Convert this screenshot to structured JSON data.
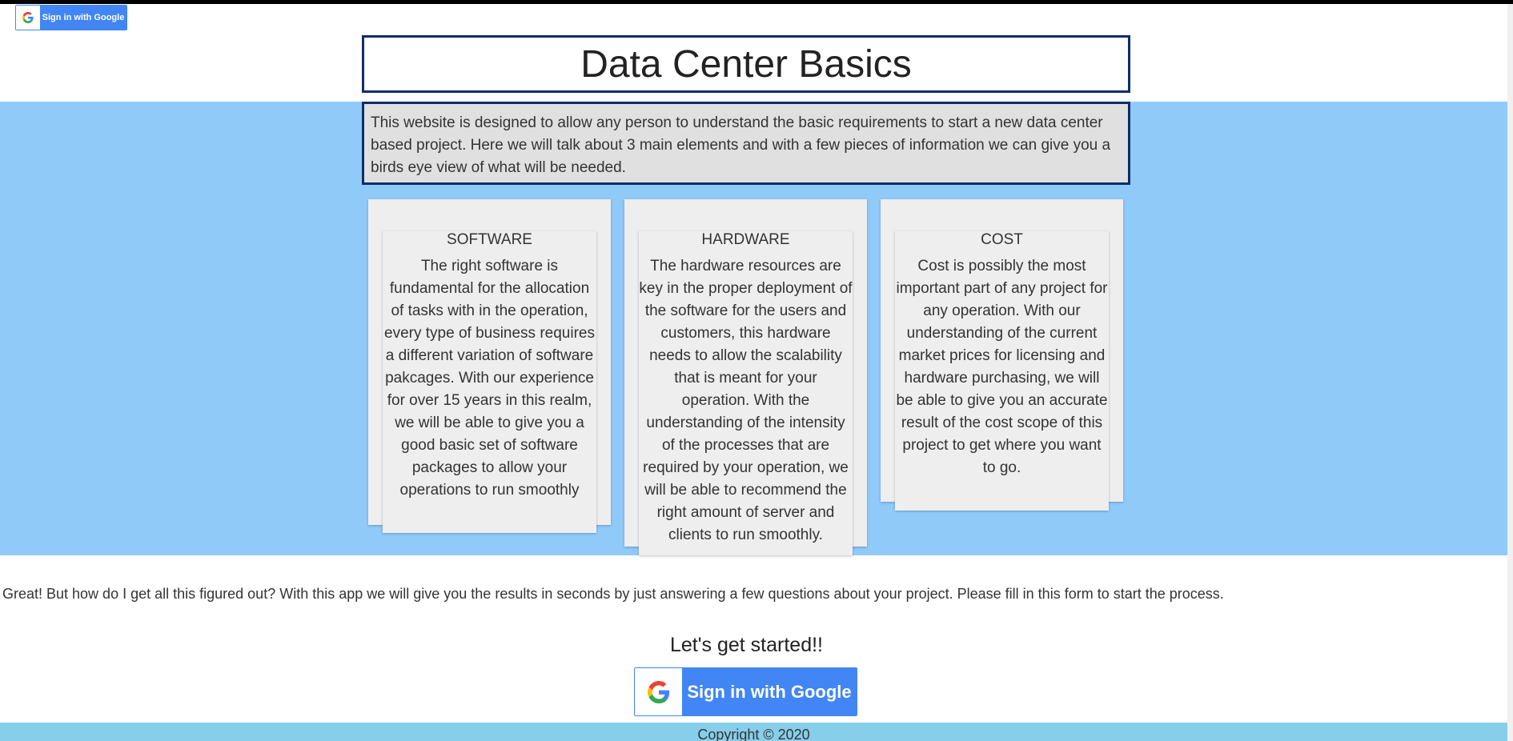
{
  "header": {
    "google_signin_label": "Sign in with Google",
    "title": "Data Center Basics"
  },
  "intro": {
    "text": "This website is designed to allow any person to understand the basic requirements to start a new data center based project. Here we will talk about 3 main elements and with a few pieces of information we can give you a birds eye view of what will be needed."
  },
  "cards": [
    {
      "title": "SOFTWARE",
      "body": "The right software is fundamental for the allocation of tasks with in the operation, every type of business requires a different variation of software pakcages. With our experience for over 15 years in this realm, we will be able to give you a good basic set of software packages to allow your operations to run smoothly"
    },
    {
      "title": "HARDWARE",
      "body": "The hardware resources are key in the proper deployment of the software for the users and customers, this hardware needs to allow the scalability that is meant for your operation. With the understanding of the intensity of the processes that are required by your operation, we will be able to recommend the right amount of server and clients to run smoothly."
    },
    {
      "title": "COST",
      "body": "Cost is possibly the most important part of any project for any operation. With our understanding of the current market prices for licensing and hardware purchasing, we will be able to give you an accurate result of the cost scope of this project to get where you want to go."
    }
  ],
  "cta": {
    "text": "Great! But how do I get all this figured out? With this app we will give you the results in seconds by just answering a few questions about your project. Please fill in this form to start the process.",
    "heading": "Let's get started!!",
    "google_signin_label": "Sign in with Google"
  },
  "footer": {
    "copyright": "Copyright © 2020"
  },
  "colors": {
    "band": "#90caf9",
    "border": "#0d2d6b",
    "google_blue": "#4285f4",
    "footer": "#87ceeb"
  }
}
